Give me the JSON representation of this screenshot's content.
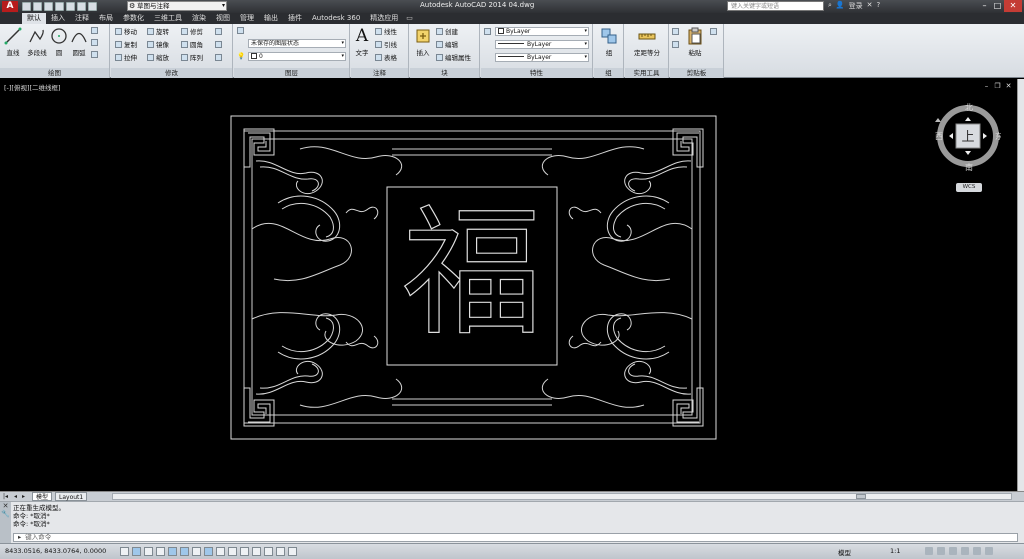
{
  "titlebar": {
    "app_title": "Autodesk AutoCAD 2014    04.dwg",
    "workspace": "草图与注释",
    "search_placeholder": "键入关键字或短语",
    "signin": "登录"
  },
  "ribbon_tabs": [
    "默认",
    "插入",
    "注释",
    "布局",
    "参数化",
    "三维工具",
    "渲染",
    "视图",
    "管理",
    "输出",
    "插件",
    "Autodesk 360",
    "精选应用"
  ],
  "panels": {
    "draw": {
      "title": "绘图",
      "line": "直线",
      "polyline": "多段线",
      "circle": "圆",
      "arc": "圆弧"
    },
    "modify": {
      "title": "修改",
      "move": "移动",
      "rotate": "旋转",
      "trim": "修剪",
      "copy": "复制",
      "mirror": "镜像",
      "fillet": "圆角",
      "stretch": "拉伸",
      "scale": "缩放",
      "array": "阵列"
    },
    "layers": {
      "title": "图层",
      "state": "未保存的图层状态",
      "current_layer": "0"
    },
    "annotation": {
      "title": "注释",
      "text": "文字",
      "linear": "线性",
      "leader": "引线",
      "table": "表格"
    },
    "block": {
      "title": "块",
      "insert": "插入",
      "create": "创建",
      "edit": "编辑",
      "edit_attributes": "编辑属性"
    },
    "properties": {
      "title": "特性",
      "color": "ByLayer",
      "linetype": "ByLayer",
      "lineweight": "ByLayer"
    },
    "groups": {
      "title": "组",
      "group": "组"
    },
    "utilities": {
      "title": "实用工具",
      "measure": "定距等分"
    },
    "clipboard": {
      "title": "剪贴板",
      "paste": "粘贴"
    }
  },
  "viewport": {
    "label": "[-][俯视][二维线框]",
    "viewcube": {
      "top": "上",
      "north": "北",
      "south": "南",
      "east": "东",
      "west": "西"
    },
    "wcs": "WCS",
    "drawing_character": "福"
  },
  "layout_tabs": [
    "模型",
    "Layout1"
  ],
  "command": {
    "history": [
      "正在重生成模型。",
      "命令: *取消*",
      "命令: *取消*"
    ],
    "input_placeholder": "键入命令"
  },
  "statusbar": {
    "coords": "8433.0516,  8433.0764,  0.0000",
    "model": "模型",
    "annotation_scale": "1:1"
  }
}
